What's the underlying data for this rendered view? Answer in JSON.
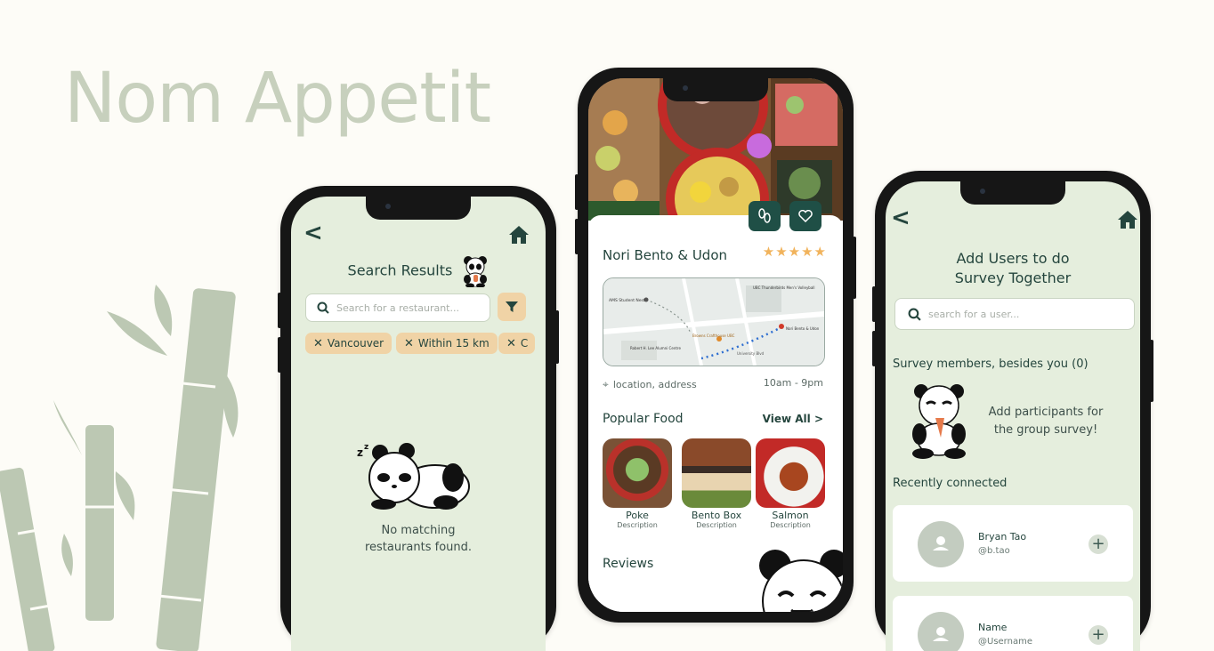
{
  "brand": {
    "title": "Nom Appetit"
  },
  "screen_search": {
    "title": "Search Results",
    "search_placeholder": "Search for a restaurant...",
    "chips": [
      "Vancouver",
      "Within 15 km",
      "C"
    ],
    "empty_line1": "No matching",
    "empty_line2": "restaurants found."
  },
  "screen_restaurant": {
    "name": "Nori Bento & Udon",
    "rating": 5,
    "location_text": "location, address",
    "hours": "10am - 9pm",
    "popular_label": "Popular Food",
    "view_all": "View All",
    "foods": [
      {
        "name": "Poke",
        "desc": "Description"
      },
      {
        "name": "Bento Box",
        "desc": "Description"
      },
      {
        "name": "Salmon",
        "desc": "Description"
      }
    ],
    "reviews_label": "Reviews",
    "map_labels": [
      "AMS Student Nest",
      "UBC Thunderbirds Men's Volleyball",
      "Browns Crafthouse UBC",
      "Nori Bento & Udon",
      "Robert H. Lee Alumni Centre",
      "University Blvd"
    ]
  },
  "screen_survey": {
    "title_line1": "Add Users to do",
    "title_line2": "Survey Together",
    "search_placeholder": "search for a user...",
    "members_label": "Survey members, besides you (0)",
    "hint_line1": "Add participants for",
    "hint_line2": "the group survey!",
    "recent_label": "Recently connected",
    "users": [
      {
        "name": "Bryan Tao",
        "handle": "@b.tao"
      },
      {
        "name": "Name",
        "handle": "@Username"
      }
    ]
  },
  "colors": {
    "accent": "#1f4f46",
    "chip": "#f0d3a6",
    "screen_bg": "#e5eedd",
    "star": "#f1b35c"
  }
}
